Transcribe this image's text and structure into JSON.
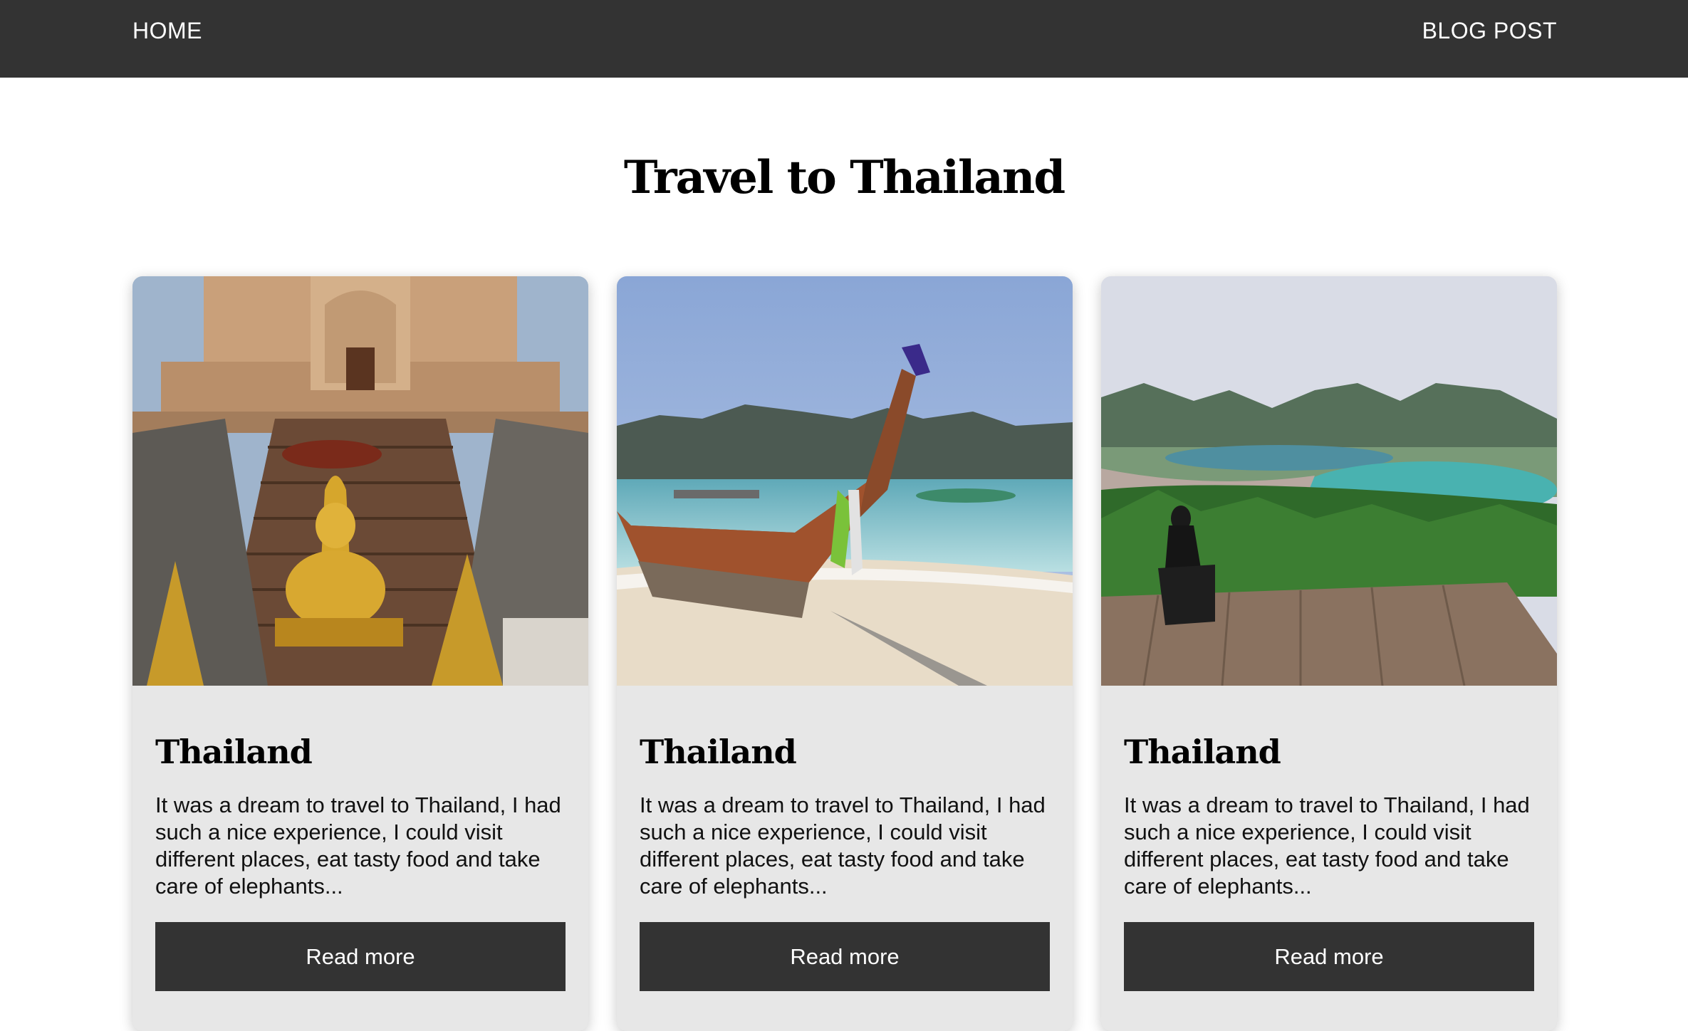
{
  "nav": {
    "home_label": "HOME",
    "blog_label": "BLOG POST"
  },
  "page": {
    "title": "Travel to Thailand"
  },
  "cards": [
    {
      "image": "temple-buddha-photo",
      "title": "Thailand",
      "text": "It was a dream to travel to Thailand, I had such a nice experience, I could visit different places, eat tasty food and take care of elephants...",
      "button_label": "Read more"
    },
    {
      "image": "longtail-boat-beach-photo",
      "title": "Thailand",
      "text": "It was a dream to travel to Thailand, I had such a nice experience, I could visit different places, eat tasty food and take care of elephants...",
      "button_label": "Read more"
    },
    {
      "image": "viewpoint-bay-photo",
      "title": "Thailand",
      "text": "It was a dream to travel to Thailand, I had such a nice experience, I could visit different places, eat tasty food and take care of elephants...",
      "button_label": "Read more"
    }
  ],
  "colors": {
    "navbar": "#333333",
    "card_background": "#e7e7e7",
    "button": "#333333"
  }
}
